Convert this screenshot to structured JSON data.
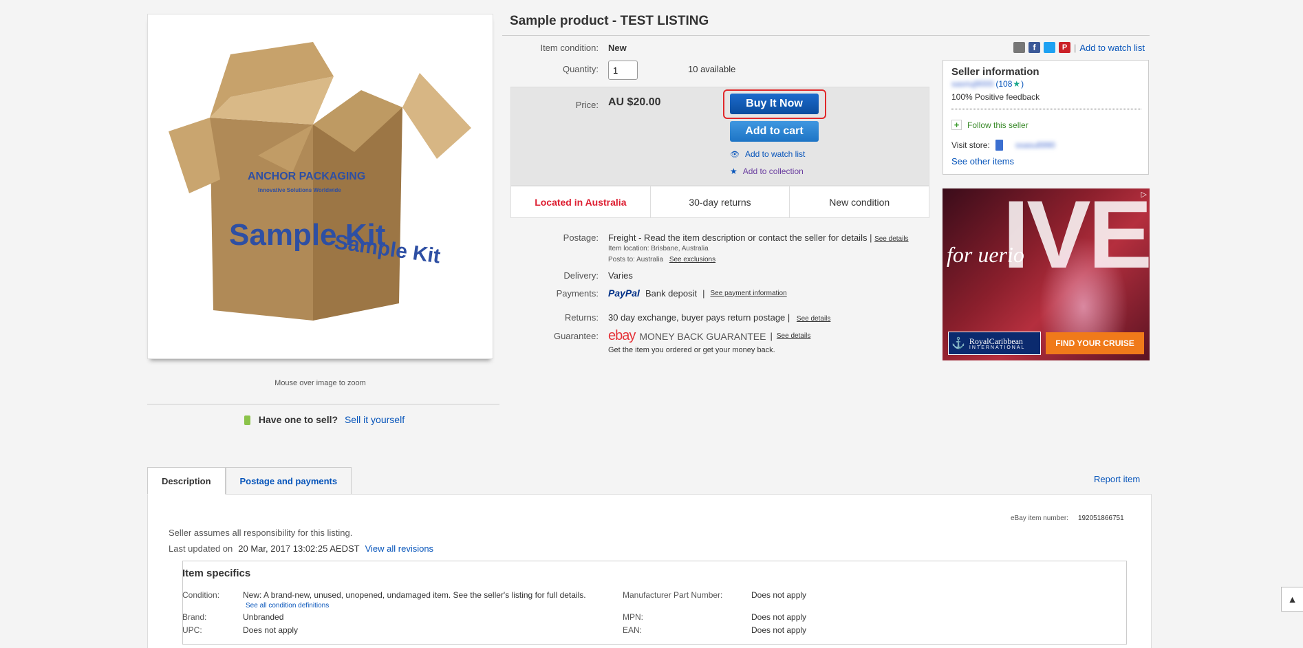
{
  "title": "Sample product - TEST LISTING",
  "image": {
    "zoom_hint": "Mouse over image to zoom",
    "box_brand": "ANCHOR PACKAGING",
    "box_tagline": "Innovative Solutions Worldwide",
    "box_text": "Sample Kit"
  },
  "sell": {
    "question": "Have one to sell?",
    "link": "Sell it yourself"
  },
  "condition": {
    "label": "Item condition:",
    "value": "New"
  },
  "quantity": {
    "label": "Quantity:",
    "value": "1",
    "available": "10 available"
  },
  "price": {
    "label": "Price:",
    "value": "AU $20.00"
  },
  "buttons": {
    "buy_now": "Buy It Now",
    "add_cart": "Add to cart",
    "watch": "Add to watch list",
    "collection": "Add to collection"
  },
  "trust": {
    "location": "Located in Australia",
    "returns": "30-day returns",
    "condition": "New condition"
  },
  "postage": {
    "label": "Postage:",
    "value": "Freight - Read the item description or contact the seller for details |",
    "see_details": "See details",
    "item_location_label": "Item location:",
    "item_location": "Brisbane, Australia",
    "posts_to_label": "Posts to:",
    "posts_to": "Australia",
    "see_exclusions": "See exclusions"
  },
  "delivery": {
    "label": "Delivery:",
    "value": "Varies"
  },
  "payments": {
    "label": "Payments:",
    "paypal": "PayPal",
    "bank": "Bank deposit",
    "sep": "|",
    "see_info": "See payment information"
  },
  "returns": {
    "label": "Returns:",
    "value": "30 day exchange, buyer pays return postage |",
    "see_details": "See details"
  },
  "guarantee": {
    "label": "Guarantee:",
    "ebay": "ebay",
    "mbg": "MONEY BACK GUARANTEE",
    "sep": "|",
    "see_details": "See details",
    "sub": "Get the item you ordered or get your money back."
  },
  "share": {
    "sep": "|",
    "watch_link": "Add to watch list"
  },
  "seller": {
    "heading": "Seller information",
    "name": "sasriuj9000",
    "score": "(108",
    "score_close": ")",
    "feedback": "100% Positive feedback",
    "follow": "Follow this seller",
    "visit_store": "Visit store:",
    "store_name": "ssasu8990",
    "other_items": "See other items"
  },
  "ad": {
    "big_text": "IVE",
    "script_text": "for uerio",
    "brand_1": "RoyalCaribbean",
    "brand_2": "INTERNATIONAL",
    "cta": "FIND YOUR CRUISE"
  },
  "tabs": [
    {
      "label": "Description"
    },
    {
      "label": "Postage and payments"
    }
  ],
  "report": "Report item",
  "item_number_label": "eBay item number:",
  "item_number": "192051866751",
  "desc": {
    "responsibility": "Seller assumes all responsibility for this listing.",
    "updated_label": "Last updated on",
    "updated_value": "20 Mar, 2017 13:02:25 AEDST",
    "revisions": "View all revisions"
  },
  "specifics": {
    "heading": "Item specifics",
    "condition_label": "Condition:",
    "condition_value": "New: A brand-new, unused, unopened, undamaged item. See the seller's listing for full details.",
    "condition_link": "See all condition definitions",
    "brand_label": "Brand:",
    "brand_value": "Unbranded",
    "upc_label": "UPC:",
    "upc_value": "Does not apply",
    "mpn_full_label": "Manufacturer Part Number:",
    "mpn_full_value": "Does not apply",
    "mpn_label": "MPN:",
    "mpn_value": "Does not apply",
    "ean_label": "EAN:",
    "ean_value": "Does not apply"
  },
  "colors": {
    "link": "#0654ba",
    "buy": "#0a4d9e",
    "cart": "#2a85d6",
    "location": "#dd1e31",
    "highlight": "#e0282a"
  }
}
